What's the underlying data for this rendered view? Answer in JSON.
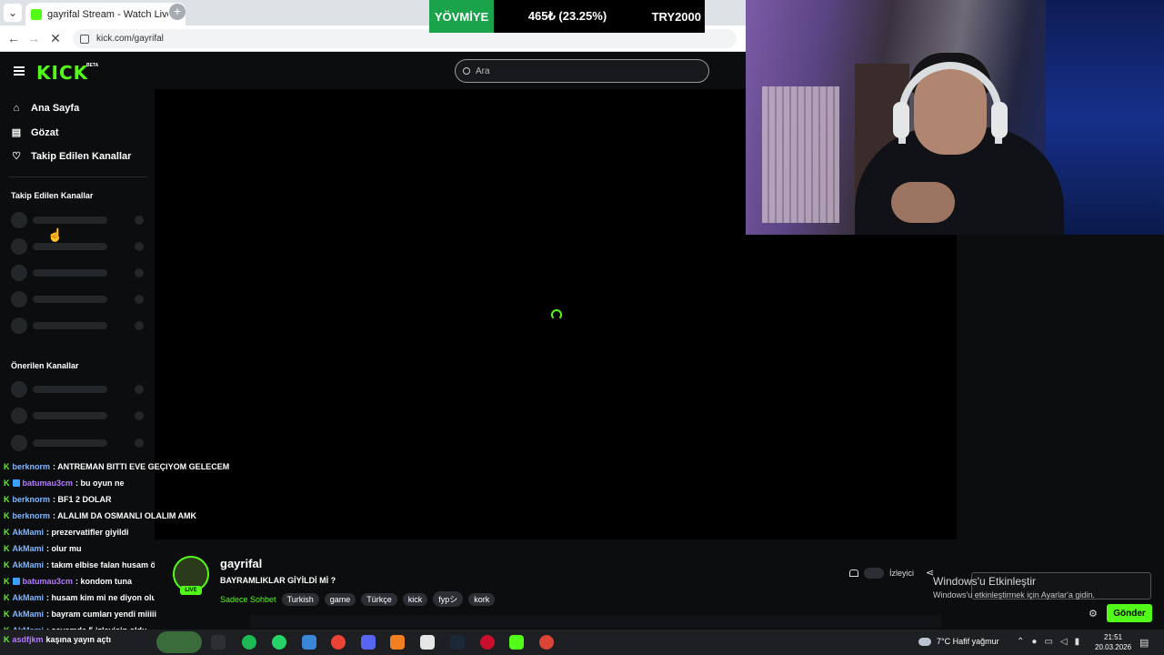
{
  "browser": {
    "tab_title": "gayrifal Stream - Watch Live on",
    "tab_close": "×",
    "new_tab": "+",
    "url": "kick.com/gayrifal",
    "back": "←",
    "forward": "→",
    "reload": "✕"
  },
  "ticker": {
    "label": "YÖVMİYE",
    "value": "465₺ (23.25%)",
    "target": "TRY2000",
    "label_color": "#1aa34a"
  },
  "header": {
    "logo": "KICK",
    "beta": "BETA",
    "search_placeholder": "Ara"
  },
  "sidebar": {
    "nav": [
      {
        "label": "Ana Sayfa",
        "icon": "home-icon"
      },
      {
        "label": "Gözat",
        "icon": "browse-icon"
      },
      {
        "label": "Takip Edilen Kanallar",
        "icon": "heart-icon"
      }
    ],
    "followed_title": "Takip Edilen Kanallar",
    "recommended_title": "Önerilen Kanallar"
  },
  "chat": {
    "messages": [
      {
        "user": "berknorm",
        "text": ": ANTREMAN BITTI EVE GEÇIYOM GELECEM",
        "color": "blue",
        "sub": false
      },
      {
        "user": "batumau3cm",
        "text": ": bu oyun ne",
        "color": "purple",
        "sub": true
      },
      {
        "user": "berknorm",
        "text": ": BF1 2 DOLAR",
        "color": "blue",
        "sub": false
      },
      {
        "user": "berknorm",
        "text": ": ALALIM DA OSMANLI OLALIM AMK",
        "color": "blue",
        "sub": false
      },
      {
        "user": "AkMami",
        "text": ": prezervatifler giyildi",
        "color": "blue",
        "sub": false
      },
      {
        "user": "AkMami",
        "text": ": olur mu",
        "color": "blue",
        "sub": false
      },
      {
        "user": "AkMami",
        "text": ": takım elbise falan husam özentisi misin",
        "color": "blue",
        "sub": false
      },
      {
        "user": "batumau3cm",
        "text": ": kondom tuna",
        "color": "purple",
        "sub": true
      },
      {
        "user": "AkMami",
        "text": ": husam kim mi ne diyon olum sen allahına",
        "color": "blue",
        "sub": false
      },
      {
        "user": "AkMami",
        "text": ": bayram cumları yendi miiiii",
        "color": "blue",
        "sub": false
      },
      {
        "user": "AkMami",
        "text": ": sayemde 5 izleyicin oldu",
        "color": "blue",
        "sub": false
      }
    ],
    "taskbar_line": {
      "user": "asdfjkm",
      "text": "kaşına yayın açtı"
    }
  },
  "stream": {
    "channel": "gayrifal",
    "title": "BAYRAMLIKLAR GİYİLDİ Mİ ?",
    "live": "LIVE",
    "language": "Sadece Sohbet",
    "tags": [
      "Turkish",
      "game",
      "Türkçe",
      "kick",
      "fypシ",
      "kork"
    ],
    "viewers_label": "İzleyici"
  },
  "chat_panel": {
    "send_label": "Gönder"
  },
  "windows": {
    "activate_title": "Windows'u Etkinleştir",
    "activate_sub": "Windows'u etkinleştirmek için Ayarlar'a gidin.",
    "weather": "7°C  Hafif yağmur",
    "time": "21:51",
    "date": "20.03.2026"
  },
  "colors": {
    "kick_green": "#53fc18",
    "background": "#0b0d0e"
  }
}
